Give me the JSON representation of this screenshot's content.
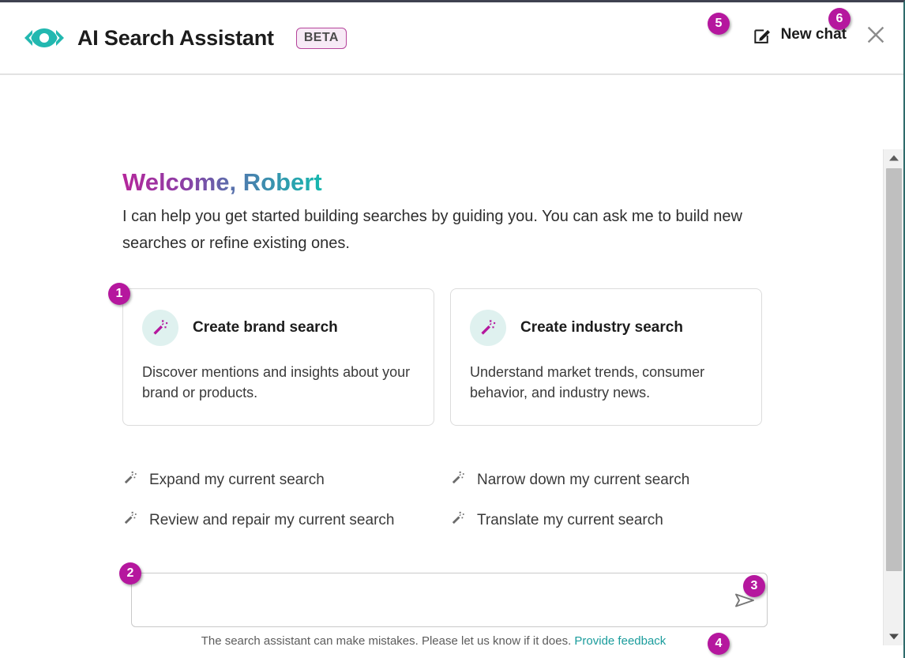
{
  "header": {
    "logo_icon": "eye-code-logo-icon",
    "title": "AI Search Assistant",
    "beta_label": "BETA",
    "new_chat_label": "New chat",
    "new_chat_icon": "edit-square-icon",
    "close_icon": "close-icon"
  },
  "main": {
    "welcome_heading": "Welcome, Robert",
    "intro_text": "I can help you get started building searches by guiding you. You can ask me to build new searches or refine existing ones.",
    "cards": [
      {
        "icon": "magic-wand-icon",
        "title": "Create brand search",
        "description": "Discover mentions and insights about your brand or products."
      },
      {
        "icon": "magic-wand-icon",
        "title": "Create industry search",
        "description": "Understand market trends, consumer behavior, and industry news."
      }
    ],
    "suggestions": [
      {
        "icon": "magic-wand-icon",
        "label": "Expand my current search"
      },
      {
        "icon": "magic-wand-icon",
        "label": "Narrow down my current search"
      },
      {
        "icon": "magic-wand-icon",
        "label": "Review and repair my current search"
      },
      {
        "icon": "magic-wand-icon",
        "label": "Translate my current search"
      }
    ]
  },
  "composer": {
    "value": "",
    "placeholder": "",
    "send_icon": "send-arrow-icon",
    "disclaimer_text": "The search assistant can make mistakes. Please let us know if it does.",
    "feedback_link_label": "Provide feedback"
  },
  "scrollbar": {
    "up_icon": "caret-up-icon",
    "down_icon": "caret-down-icon"
  },
  "annotations": {
    "badge1": "1",
    "badge2": "2",
    "badge3": "3",
    "badge4": "4",
    "badge5": "5",
    "badge6": "6"
  },
  "colors": {
    "brand_teal": "#16b8ae",
    "brand_magenta": "#b5179e",
    "link_teal": "#1a9c9c",
    "icon_circle_bg": "#dff1ef"
  }
}
